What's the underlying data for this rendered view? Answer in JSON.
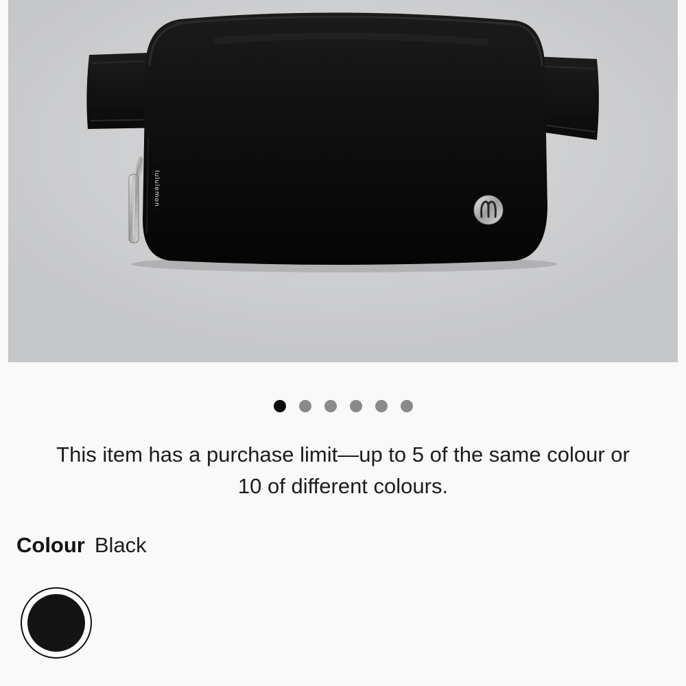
{
  "product": {
    "image_alt": "Black belt bag with silver zipper pull and logo",
    "carousel": {
      "total": 6,
      "active_index": 0
    }
  },
  "purchase_limit": {
    "line1": "This item has a purchase limit—up to 5 of the same colour or",
    "line2": "10 of different colours."
  },
  "colour": {
    "label": "Colour",
    "value": "Black",
    "swatches": [
      {
        "name": "Black",
        "color": "#141414",
        "selected": true
      }
    ]
  },
  "colors": {
    "background": "#f9f9f9",
    "dot_active": "#0d0d0d",
    "dot_inactive": "#8a8a8a"
  }
}
